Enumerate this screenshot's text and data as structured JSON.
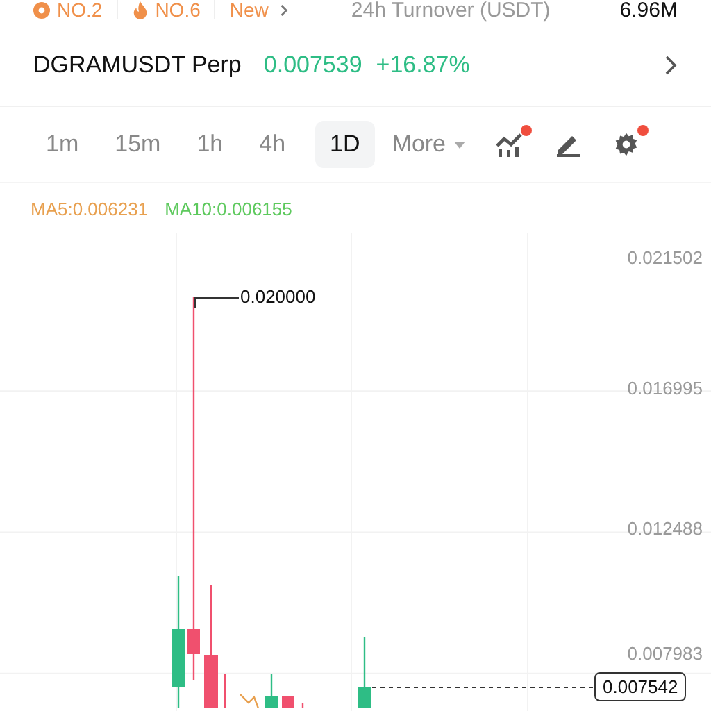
{
  "rank_badges": [
    {
      "kind": "rank",
      "label": "NO.2"
    },
    {
      "kind": "hot",
      "label": "NO.6"
    },
    {
      "kind": "new",
      "label": "New"
    }
  ],
  "turnover": {
    "label": "24h Turnover (USDT)",
    "value": "6.96M"
  },
  "instrument": {
    "symbol": "DGRAMUSDT Perp",
    "price": "0.007539",
    "change": "+16.87%"
  },
  "intervals": [
    {
      "label": "1m",
      "selected": false
    },
    {
      "label": "15m",
      "selected": false
    },
    {
      "label": "1h",
      "selected": false
    },
    {
      "label": "4h",
      "selected": false
    },
    {
      "label": "1D",
      "selected": true
    }
  ],
  "more": {
    "label": "More"
  },
  "tools": [
    {
      "kind": "indicators",
      "badge": true
    },
    {
      "kind": "draw",
      "badge": false
    },
    {
      "kind": "settings",
      "badge": true
    }
  ],
  "chart": {
    "ma": [
      {
        "label": "MA5:0.006231",
        "color": "#e8a04f"
      },
      {
        "label": "MA10:0.006155",
        "color": "#5dc95d"
      }
    ],
    "y_labels": [
      "0.021502",
      "0.016995",
      "0.012488",
      "0.007983"
    ],
    "high_marker": "0.020000",
    "last_price": "0.007542"
  }
}
